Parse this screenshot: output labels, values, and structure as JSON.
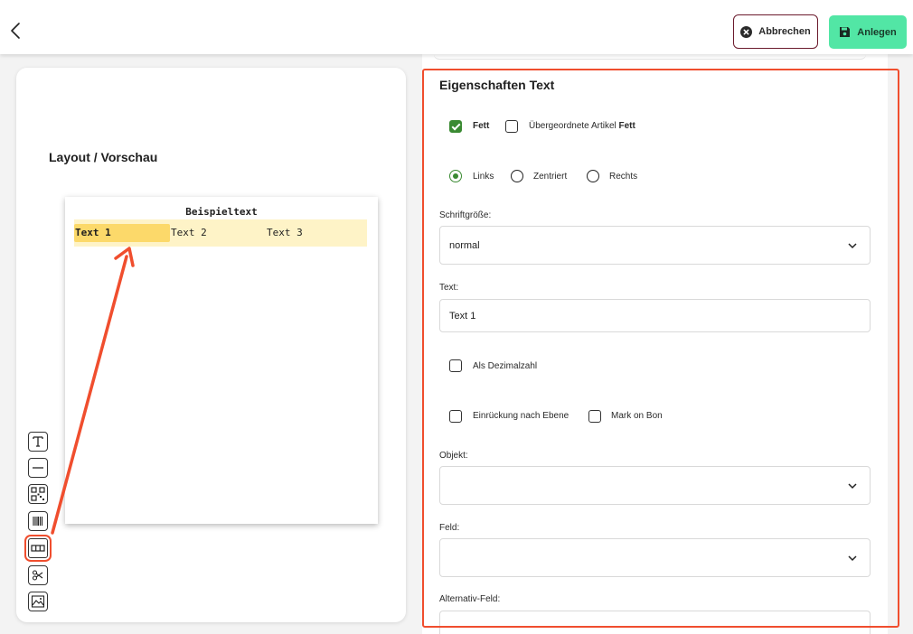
{
  "header": {
    "cancel_label": "Abbrechen",
    "create_label": "Anlegen"
  },
  "preview": {
    "title": "Layout / Vorschau",
    "paper_heading": "Beispieltext",
    "row_cells": [
      "Text 1",
      "Text 2",
      "Text 3"
    ],
    "selected_cell": 0
  },
  "props": {
    "title": "Eigenschaften Text",
    "bold_label": "Fett",
    "bold_checked": true,
    "parent_label": "Übergeordnete Artikel",
    "parent_bold_suffix": "Fett",
    "parent_checked": false,
    "align_left": "Links",
    "align_center": "Zentriert",
    "align_right": "Rechts",
    "align_selected": "left",
    "font_size_label": "Schriftgröße:",
    "font_size_value": "normal",
    "text_label": "Text:",
    "text_value": "Text 1",
    "decimal_label": "Als Dezimalzahl",
    "indent_label": "Einrückung nach Ebene",
    "mark_label": "Mark on Bon",
    "object_label": "Objekt:",
    "object_value": "",
    "field_label": "Feld:",
    "field_value": "",
    "alt_field_label": "Alternativ-Feld:"
  },
  "colors": {
    "accent_green": "#52e6a5",
    "check_green": "#3a8a32",
    "highlight_red": "#f04e2e",
    "cancel_border": "#6b1a2c",
    "row_highlight": "#fef3c7",
    "cell_selected": "#fcd96a"
  },
  "icons": {
    "back": "chevron-left-icon",
    "cancel": "close-circle-icon",
    "create": "floppy-disk-icon",
    "tools": [
      "text-tool-icon",
      "line-tool-icon",
      "qr-code-tool-icon",
      "barcode-tool-icon",
      "table-row-tool-icon",
      "cut-tool-icon",
      "image-tool-icon"
    ]
  }
}
